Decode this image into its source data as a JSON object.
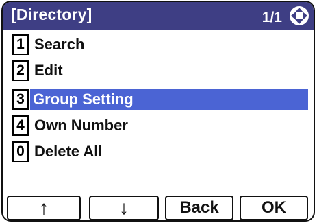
{
  "header": {
    "title": "[Directory]",
    "page_indicator": "1/1",
    "nav_icon": "four-way-navigation-icon"
  },
  "menu": {
    "items": [
      {
        "key": "1",
        "label": "Search",
        "selected": false
      },
      {
        "key": "2",
        "label": "Edit",
        "selected": false
      },
      {
        "key": "3",
        "label": "Group Setting",
        "selected": true
      },
      {
        "key": "4",
        "label": "Own Number",
        "selected": false
      },
      {
        "key": "0",
        "label": "Delete All",
        "selected": false
      }
    ]
  },
  "softkeys": {
    "up": "↑",
    "down": "↓",
    "back": "Back",
    "ok": "OK"
  },
  "colors": {
    "header_bg": "#3e3e84",
    "selection_bg": "#4b64d4"
  }
}
